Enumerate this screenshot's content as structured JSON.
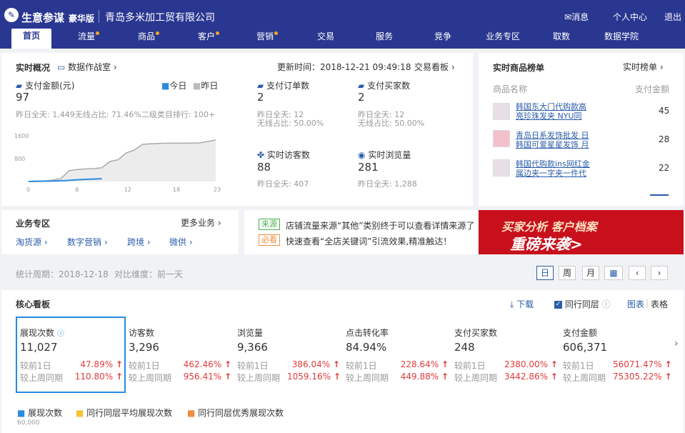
{
  "header": {
    "brand": "生意参谋",
    "edition": "豪华版",
    "company": "青岛多米加工贸有限公司",
    "message": "消息",
    "profile": "个人中心",
    "logout": "退出"
  },
  "nav": [
    "首页",
    "流量",
    "商品",
    "客户",
    "营销",
    "交易",
    "服务",
    "竞争",
    "业务专区",
    "取数",
    "数据学院"
  ],
  "realtime": {
    "title": "实时概况",
    "war_room": "数据作战室",
    "update_time": "更新时间：2018-12-21 09:49:18",
    "trade_board": "交易看板",
    "pay_amount_label": "支付金额(元)",
    "pay_amount": "97",
    "legend_today": "今日",
    "legend_yesterday": "昨日",
    "pay_amount_sub": "昨日全天: 1,449无线占比: 71.46%二级类目排行: 100+",
    "pay_orders_label": "支付订单数",
    "pay_orders": "2",
    "pay_orders_sub1": "昨日全天: 12",
    "pay_orders_sub2": "无线占比: 50.00%",
    "pay_buyers_label": "支付买家数",
    "pay_buyers": "2",
    "pay_buyers_sub1": "昨日全天: 12",
    "pay_buyers_sub2": "无线占比: 50.00%",
    "visitors_label": "实时访客数",
    "visitors": "88",
    "visitors_sub": "昨日全天: 407",
    "pv_label": "实时浏览量",
    "pv": "281",
    "pv_sub": "昨日全天: 1,288"
  },
  "chart_data": {
    "type": "area",
    "x": [
      0,
      6,
      12,
      18,
      23
    ],
    "yticks": [
      800,
      1600
    ],
    "y_labels": [
      "1600",
      "800"
    ],
    "x_labels": [
      "0",
      "6",
      "12",
      "18",
      "23"
    ],
    "series": [
      {
        "name": "昨日",
        "values": [
          0,
          15,
          20,
          50,
          110,
          380,
          420,
          440,
          450,
          480,
          700,
          760,
          1000,
          1100,
          1300,
          1320,
          1330,
          1340,
          1340,
          1340,
          1345,
          1350,
          1400,
          1449
        ]
      },
      {
        "name": "今日",
        "values": [
          0,
          10,
          15,
          30,
          60,
          80,
          97
        ]
      }
    ],
    "ylim": [
      0,
      1800
    ],
    "xlim": [
      0,
      23
    ]
  },
  "rank": {
    "title": "实时商品榜单",
    "link": "实时榜单",
    "col1": "商品名称",
    "col2": "支付金额",
    "items": [
      {
        "name1": "韩国东大门代购款高",
        "name2": "亮珍珠发夹 NYU同",
        "value": "45"
      },
      {
        "name1": "青岛日系发饰批发 日",
        "name2": "韩国可爱星星发饰 月",
        "value": "28"
      },
      {
        "name1": "韩国代购款ins网红金",
        "name2": "属边夹一字夹一件代",
        "value": "22"
      }
    ]
  },
  "biz": {
    "title": "业务专区",
    "more": "更多业务",
    "links": [
      "淘货源",
      "数字营销",
      "跨境",
      "微供"
    ]
  },
  "notice": {
    "tag1": "来源",
    "text1": "店铺流量来源“其他”类别终于可以查看详情来源了",
    "tag2": "必看",
    "text2": "快速查看“全店关键词”引流效果,精准触达！"
  },
  "banner": {
    "line1": "买家分析  客户档案",
    "line2": "重磅来袭>"
  },
  "filter": {
    "period": "统计周期：2018-12-18",
    "compare": "对比维度：前一天",
    "day": "日",
    "week": "周",
    "month": "月"
  },
  "core": {
    "title": "核心看板",
    "download": "下载",
    "peer": "行同层",
    "chart": "图表",
    "table": "表格",
    "metrics": [
      {
        "name": "展现次数",
        "value": "11,027",
        "d1": "47.89%",
        "w1": "110.80%"
      },
      {
        "name": "访客数",
        "value": "3,296",
        "d1": "462.46%",
        "w1": "956.41%"
      },
      {
        "name": "浏览量",
        "value": "9,366",
        "d1": "386.04%",
        "w1": "1059.16%"
      },
      {
        "name": "点击转化率",
        "value": "84.94%",
        "d1": "228.64%",
        "w1": "449.88%"
      },
      {
        "name": "支付买家数",
        "value": "248",
        "d1": "2380.00%",
        "w1": "3442.86%"
      },
      {
        "name": "支付金额",
        "value": "606,371",
        "d1": "56071.47%",
        "w1": "75305.22%"
      }
    ],
    "cmp_day": "较前1日",
    "cmp_week": "较上周同期",
    "legend": [
      "展现次数",
      "同行同层平均展现次数",
      "同行同层优秀展现次数"
    ],
    "y_top": "60,000"
  },
  "colors": {
    "nav_bg": "#2a3791",
    "accent": "#2a5caa",
    "red": "#e03c3c",
    "legend_yellow": "#f5c431",
    "legend_orange": "#f08c3c"
  }
}
